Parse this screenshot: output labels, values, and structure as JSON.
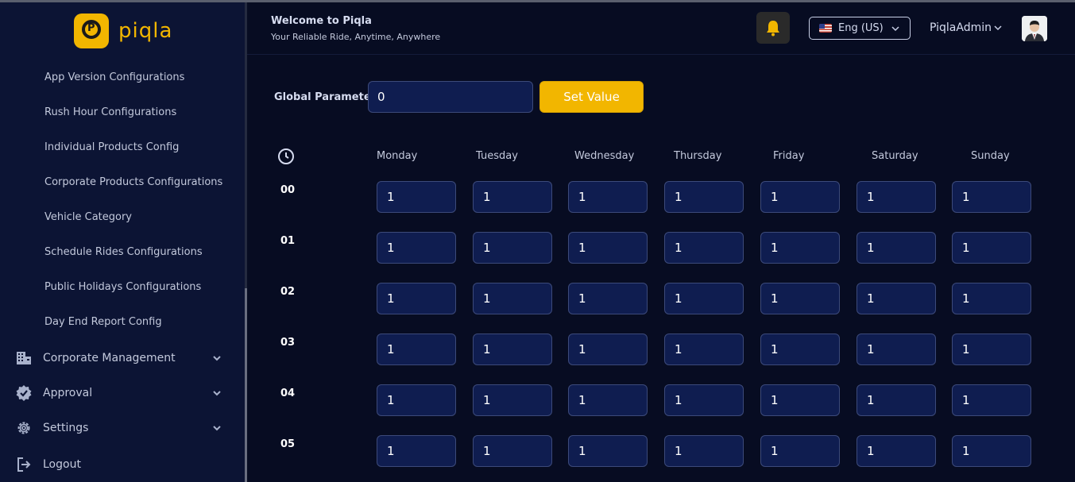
{
  "brand": {
    "logo_text": "piqla",
    "badge_letter": "P",
    "accent": "#f2b600"
  },
  "sidebar": {
    "sub_items": [
      "App Version Configurations",
      "Rush Hour Configurations",
      "Individual Products Config",
      "Corporate Products Configurations",
      "Vehicle Category",
      "Schedule Rides Configurations",
      "Public Holidays Configurations",
      "Day End Report Config"
    ],
    "menu_items": [
      {
        "label": "Corporate Management",
        "icon": "building-icon"
      },
      {
        "label": "Approval",
        "icon": "badge-check-icon"
      },
      {
        "label": "Settings",
        "icon": "gear-icon"
      },
      {
        "label": "Logout",
        "icon": "logout-icon"
      }
    ]
  },
  "header": {
    "welcome": "Welcome to Piqla",
    "tagline": "Your Reliable Ride, Anytime, Anywhere",
    "language": "Eng (US)",
    "user": "PiqlaAdmin"
  },
  "global_parameter": {
    "label": "Global Parameter",
    "value": "0",
    "button": "Set Value"
  },
  "schedule": {
    "days": [
      "Monday",
      "Tuesday",
      "Wednesday",
      "Thursday",
      "Friday",
      "Saturday",
      "Sunday"
    ],
    "hours": [
      "00",
      "01",
      "02",
      "03",
      "04",
      "05"
    ],
    "values": [
      [
        "1",
        "1",
        "1",
        "1",
        "1",
        "1",
        "1"
      ],
      [
        "1",
        "1",
        "1",
        "1",
        "1",
        "1",
        "1"
      ],
      [
        "1",
        "1",
        "1",
        "1",
        "1",
        "1",
        "1"
      ],
      [
        "1",
        "1",
        "1",
        "1",
        "1",
        "1",
        "1"
      ],
      [
        "1",
        "1",
        "1",
        "1",
        "1",
        "1",
        "1"
      ],
      [
        "1",
        "1",
        "1",
        "1",
        "1",
        "1",
        "1"
      ]
    ]
  }
}
